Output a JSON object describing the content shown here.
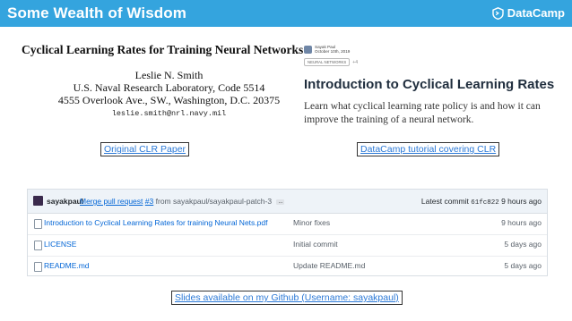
{
  "header": {
    "title": "Some Wealth of Wisdom",
    "brand_name": "DataCamp",
    "background": "#34a4de"
  },
  "paper": {
    "title": "Cyclical Learning Rates for Training Neural Networks",
    "author": "Leslie N. Smith",
    "affiliation": "U.S. Naval Research Laboratory, Code 5514",
    "address": "4555 Overlook Ave., SW., Washington, D.C. 20375",
    "email": "leslie.smith@nrl.navy.mil"
  },
  "tutorial": {
    "author": "Sayak Paul",
    "date": "October 10th, 2019",
    "tag": "NEURAL NETWORKS",
    "tag_extra": "+4",
    "title": "Introduction to Cyclical Learning Rates",
    "description": "Learn what cyclical learning rate policy is and how it can improve the training of a neural network."
  },
  "links": {
    "clr_paper": "Original CLR Paper",
    "tutorial": "DataCamp tutorial covering CLR",
    "slides": "Slides available on my Github (Username: sayakpaul)"
  },
  "repo": {
    "commit_user": "sayakpaul",
    "commit_msg_link": "Merge pull request",
    "commit_pr": "#3",
    "commit_msg_rest": "from sayakpaul/sayakpaul-patch-3",
    "ellipsis": "...",
    "latest_label": "Latest commit",
    "latest_sha": "61fc822",
    "latest_age": "9 hours ago",
    "files": [
      {
        "name": "Introduction to Cyclical Learning Rates for training Neural Nets.pdf",
        "message": "Minor fixes",
        "age": "9 hours ago"
      },
      {
        "name": "LICENSE",
        "message": "Initial commit",
        "age": "5 days ago"
      },
      {
        "name": "README.md",
        "message": "Update README.md",
        "age": "5 days ago"
      }
    ]
  },
  "colors": {
    "link": "#2a78d6",
    "github_link": "#0366d6"
  }
}
